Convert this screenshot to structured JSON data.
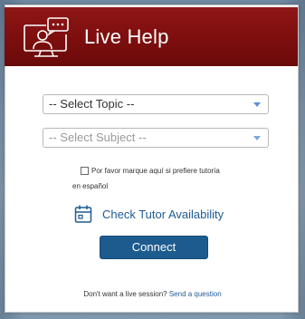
{
  "header": {
    "title": "Live Help",
    "background_color": "#7d0e0e",
    "icon": "live-chat-icon"
  },
  "form": {
    "topic_select": {
      "placeholder": "-- Select Topic --"
    },
    "subject_select": {
      "placeholder": "-- Select Subject --"
    },
    "spanish_option": {
      "label_line1": "Por favor marque aquí si prefiere tutoría",
      "label_line2": "en español",
      "checked": false
    },
    "availability_link": {
      "label": "Check Tutor Availability",
      "icon": "calendar-icon"
    },
    "connect_button": {
      "label": "Connect",
      "color": "#1d5b8f"
    }
  },
  "footer": {
    "prompt": "Don't want a live session?",
    "link": "Send a question",
    "link_color": "#1f5a94"
  }
}
